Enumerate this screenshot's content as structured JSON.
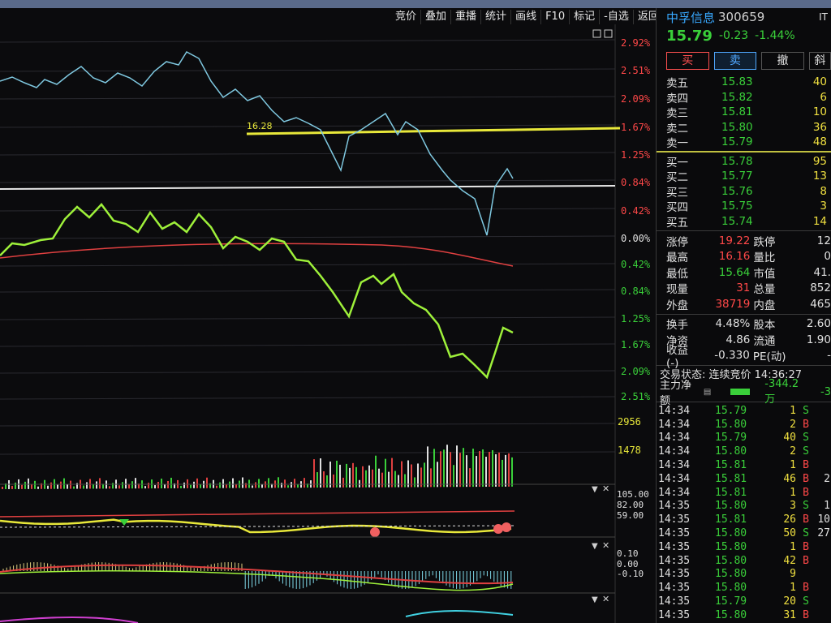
{
  "toolbar": [
    "竞价",
    "叠加",
    "重播",
    "统计",
    "画线",
    "F10",
    "标记",
    "-自选",
    "返回"
  ],
  "stock": {
    "name": "中孚信息",
    "code": "300659",
    "price": "15.79",
    "change": "-0.23",
    "change_pct": "-1.44%",
    "corner": "IT"
  },
  "buttons": {
    "buy": "买",
    "sell": "卖",
    "cancel": "撤",
    "more": "斜"
  },
  "asks": [
    {
      "label": "卖五",
      "price": "15.83",
      "vol": "40"
    },
    {
      "label": "卖四",
      "price": "15.82",
      "vol": "6"
    },
    {
      "label": "卖三",
      "price": "15.81",
      "vol": "10"
    },
    {
      "label": "卖二",
      "price": "15.80",
      "vol": "36"
    },
    {
      "label": "卖一",
      "price": "15.79",
      "vol": "48"
    }
  ],
  "bids": [
    {
      "label": "买一",
      "price": "15.78",
      "vol": "95"
    },
    {
      "label": "买二",
      "price": "15.77",
      "vol": "13"
    },
    {
      "label": "买三",
      "price": "15.76",
      "vol": "8"
    },
    {
      "label": "买四",
      "price": "15.75",
      "vol": "3"
    },
    {
      "label": "买五",
      "price": "15.74",
      "vol": "14"
    }
  ],
  "stats": [
    {
      "l1": "涨停",
      "v1": "19.22",
      "c1": "#ff4848",
      "l2": "跌停",
      "v2": "12"
    },
    {
      "l1": "最高",
      "v1": "16.16",
      "c1": "#ff4848",
      "l2": "量比",
      "v2": "0"
    },
    {
      "l1": "最低",
      "v1": "15.64",
      "c1": "#3ad03a",
      "l2": "市值",
      "v2": "41."
    },
    {
      "l1": "现量",
      "v1": "31",
      "c1": "#ff4848",
      "l2": "总量",
      "v2": "852"
    },
    {
      "l1": "外盘",
      "v1": "38719",
      "c1": "#ff4848",
      "l2": "内盘",
      "v2": "465"
    }
  ],
  "stats2": [
    {
      "l1": "换手",
      "v1": "4.48%",
      "c1": "#e0e0e0",
      "l2": "股本",
      "v2": "2.60"
    },
    {
      "l1": "净资",
      "v1": "4.86",
      "c1": "#e0e0e0",
      "l2": "流通",
      "v2": "1.90"
    },
    {
      "l1": "收益(-)",
      "v1": "-0.330",
      "c1": "#e0e0e0",
      "l2": "PE(动)",
      "v2": "-"
    }
  ],
  "status": {
    "label": "交易状态:",
    "value": "连续竞价 14:36:27"
  },
  "flow": {
    "label": "主力净额",
    "value": "-344.2万",
    "extra": "-3"
  },
  "ticks": [
    {
      "t": "14:34",
      "p": "15.79",
      "v": "1",
      "s": "S",
      "x": ""
    },
    {
      "t": "14:34",
      "p": "15.80",
      "v": "2",
      "s": "B",
      "x": ""
    },
    {
      "t": "14:34",
      "p": "15.79",
      "v": "40",
      "s": "S",
      "x": ""
    },
    {
      "t": "14:34",
      "p": "15.80",
      "v": "2",
      "s": "S",
      "x": ""
    },
    {
      "t": "14:34",
      "p": "15.81",
      "v": "1",
      "s": "B",
      "x": ""
    },
    {
      "t": "14:34",
      "p": "15.81",
      "v": "46",
      "s": "B",
      "x": "2"
    },
    {
      "t": "14:34",
      "p": "15.81",
      "v": "1",
      "s": "B",
      "x": ""
    },
    {
      "t": "14:35",
      "p": "15.80",
      "v": "3",
      "s": "S",
      "x": "1"
    },
    {
      "t": "14:35",
      "p": "15.81",
      "v": "26",
      "s": "B",
      "x": "10"
    },
    {
      "t": "14:35",
      "p": "15.80",
      "v": "50",
      "s": "S",
      "x": "27"
    },
    {
      "t": "14:35",
      "p": "15.80",
      "v": "1",
      "s": "B",
      "x": ""
    },
    {
      "t": "14:35",
      "p": "15.80",
      "v": "42",
      "s": "B",
      "x": ""
    },
    {
      "t": "14:35",
      "p": "15.80",
      "v": "9",
      "s": "",
      "x": ""
    },
    {
      "t": "14:35",
      "p": "15.80",
      "v": "1",
      "s": "B",
      "x": ""
    },
    {
      "t": "14:35",
      "p": "15.79",
      "v": "20",
      "s": "S",
      "x": ""
    },
    {
      "t": "14:35",
      "p": "15.80",
      "v": "31",
      "s": "B",
      "x": ""
    }
  ],
  "pct_labels_up": [
    {
      "text": "2.92%",
      "cls": "red"
    },
    {
      "text": "2.51%",
      "cls": "red"
    },
    {
      "text": "2.09%",
      "cls": "red"
    },
    {
      "text": "1.67%",
      "cls": "red"
    },
    {
      "text": "1.25%",
      "cls": "red"
    },
    {
      "text": "0.84%",
      "cls": "red"
    },
    {
      "text": "0.42%",
      "cls": "red"
    },
    {
      "text": "0.00%",
      "cls": "white"
    },
    {
      "text": "0.42%",
      "cls": "green"
    },
    {
      "text": "0.84%",
      "cls": "green"
    },
    {
      "text": "1.25%",
      "cls": "green"
    },
    {
      "text": "1.67%",
      "cls": "green"
    },
    {
      "text": "2.09%",
      "cls": "green"
    },
    {
      "text": "2.51%",
      "cls": "green"
    }
  ],
  "vol_labels": [
    "2956",
    "1478"
  ],
  "ind_labels": [
    "105.00",
    "82.00",
    "59.00"
  ],
  "macd_labels": [
    "0.10",
    "0.00",
    "-0.10"
  ],
  "level_line_label": "16.28",
  "colors": {
    "up": "#ff4848",
    "down": "#3ad03a",
    "price_line": "#7fc8e0",
    "avg_line": "#9ef03a",
    "level": "#e8e83a"
  }
}
